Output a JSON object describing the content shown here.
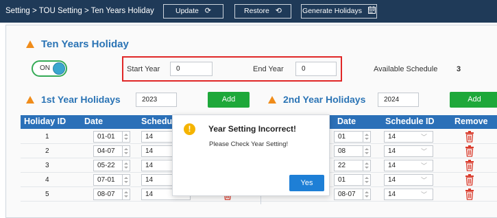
{
  "header": {
    "breadcrumb": "Setting > TOU Setting > Ten Years Holiday",
    "update_label": "Update",
    "restore_label": "Restore",
    "generate_label": "Generate Holidays"
  },
  "section": {
    "title": "Ten Years Holiday",
    "toggle_label": "ON",
    "start_year_label": "Start Year",
    "start_year_value": "0",
    "end_year_label": "End Year",
    "end_year_value": "0",
    "available_label": "Available Schedule",
    "available_value": "3"
  },
  "colors": {
    "header_bg": "#1f3a58",
    "table_header_bg": "#2b70b8",
    "add_green": "#1ea83a",
    "highlight_red": "#e02626",
    "title_blue": "#2b74b5",
    "accent_orange": "#f08c1a",
    "trash_red": "#d93a2b",
    "dialog_button_blue": "#1e7fd6"
  },
  "year1": {
    "title": "1st Year Holidays",
    "year": "2023",
    "add_label": "Add",
    "columns": [
      "Holiday ID",
      "Date",
      "Schedule ID"
    ],
    "rows": [
      {
        "id": "1",
        "date": "01-01",
        "schedule": "14"
      },
      {
        "id": "2",
        "date": "04-07",
        "schedule": "14"
      },
      {
        "id": "3",
        "date": "05-22",
        "schedule": "14"
      },
      {
        "id": "4",
        "date": "07-01",
        "schedule": "14"
      },
      {
        "id": "5",
        "date": "08-07",
        "schedule": "14"
      }
    ]
  },
  "year2": {
    "title": "2nd Year Holidays",
    "year": "2024",
    "add_label": "Add",
    "columns": [
      "Date",
      "Schedule ID",
      "Remove"
    ],
    "rows": [
      {
        "id": "",
        "date": "01",
        "schedule": "14"
      },
      {
        "id": "",
        "date": "08",
        "schedule": "14"
      },
      {
        "id": "",
        "date": "22",
        "schedule": "14"
      },
      {
        "id": "",
        "date": "01",
        "schedule": "14"
      },
      {
        "id": "5",
        "date": "08-07",
        "schedule": "14"
      }
    ]
  },
  "dialog": {
    "title": "Year Setting Incorrect!",
    "message": "Please Check Year Setting!",
    "yes_label": "Yes"
  },
  "icons": {
    "update": "refresh-icon",
    "restore": "history-icon",
    "generate": "calendar-icon",
    "toggle": "toggle-switch",
    "remove": "trash-icon",
    "warning": "warning-icon"
  }
}
